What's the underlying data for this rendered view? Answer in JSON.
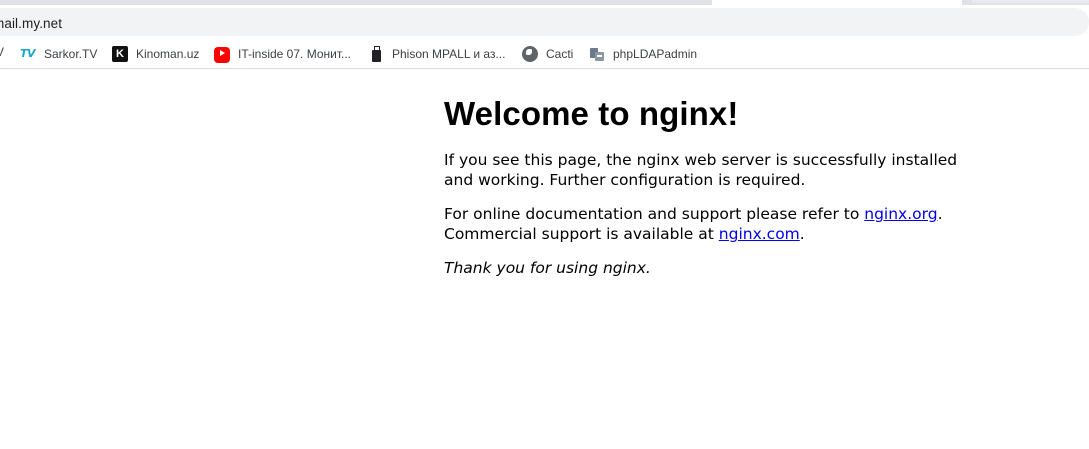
{
  "browser": {
    "address_bar": {
      "url": "mail.my.net"
    },
    "bookmarks": {
      "partial_item": "V",
      "items": [
        {
          "label": "Sarkor.TV",
          "icon": "sarkor-tv-icon"
        },
        {
          "label": "Kinoman.uz",
          "icon": "kinoman-k-icon"
        },
        {
          "label": "IT-inside 07. Монит...",
          "icon": "youtube-icon"
        },
        {
          "label": "Phison MPALL и аз...",
          "icon": "usb-drive-icon"
        },
        {
          "label": "Cacti",
          "icon": "globe-icon"
        },
        {
          "label": "phpLDAPadmin",
          "icon": "phpldapadmin-icon"
        }
      ]
    }
  },
  "page": {
    "heading": "Welcome to nginx!",
    "para1": "If you see this page, the nginx web server is successfully installed and working. Further configuration is required.",
    "para2": {
      "text_before": "For online documentation and support please refer to ",
      "link1": "nginx.org",
      "text_mid": ".",
      "line2_before": "Commercial support is available at ",
      "link2": "nginx.com",
      "text_end": "."
    },
    "thanks": "Thank you for using nginx."
  }
}
